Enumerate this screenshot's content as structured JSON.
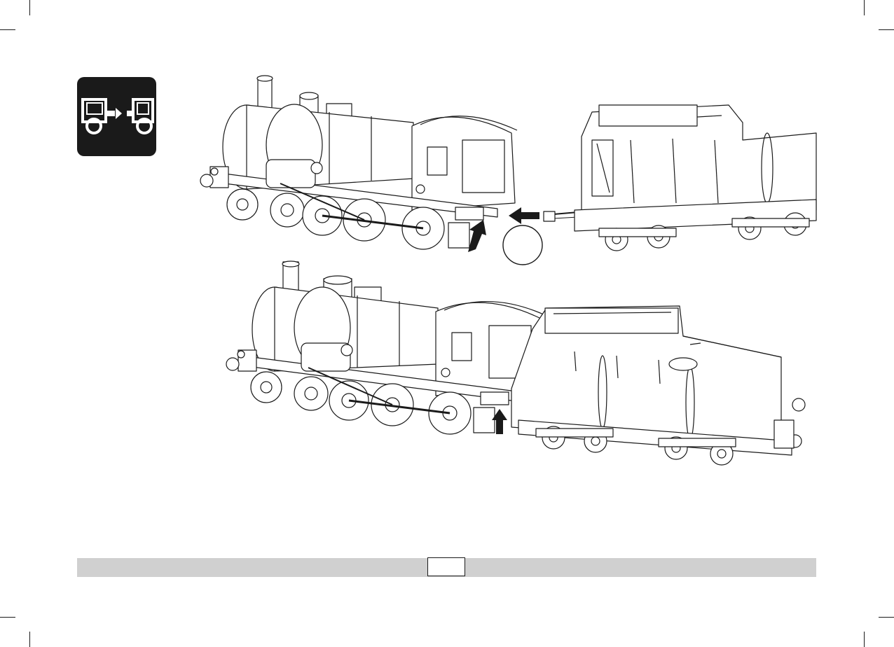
{
  "page": {
    "icon": "locomotive-tender-coupling-icon",
    "page_number": "",
    "step_circle_label": "",
    "colors": {
      "ink": "#1a1a1a",
      "footer": "#d0d0d0",
      "background": "#ffffff"
    }
  },
  "illustration": {
    "top": "locomotive-and-tender-separated",
    "bottom": "locomotive-and-tender-coupled",
    "arrows": [
      "arrow-up-to-connector",
      "arrow-left-insert-cable",
      "arrow-up-to-connector"
    ]
  }
}
